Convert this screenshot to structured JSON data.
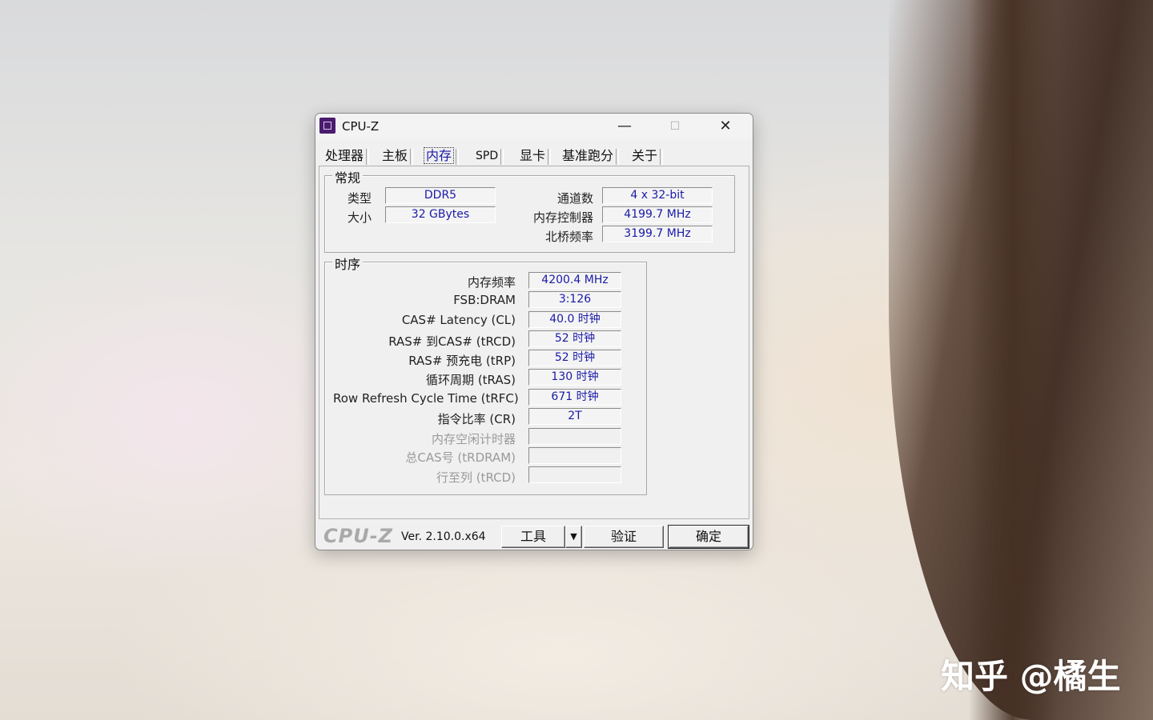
{
  "window": {
    "title": "CPU-Z",
    "minimize_glyph": "—",
    "maximize_glyph": "☐",
    "close_glyph": "✕"
  },
  "tabs": [
    {
      "label": "处理器"
    },
    {
      "label": "主板"
    },
    {
      "label": "内存",
      "active": true
    },
    {
      "label": "SPD"
    },
    {
      "label": "显卡"
    },
    {
      "label": "基准跑分"
    },
    {
      "label": "关于"
    }
  ],
  "general": {
    "title": "常规",
    "type_label": "类型",
    "type_value": "DDR5",
    "size_label": "大小",
    "size_value": "32 GBytes",
    "channels_label": "通道数",
    "channels_value": "4 x 32-bit",
    "mem_controller_label": "内存控制器",
    "mem_controller_value": "4199.7 MHz",
    "northbridge_label": "北桥频率",
    "northbridge_value": "3199.7 MHz"
  },
  "timings": {
    "title": "时序",
    "rows": [
      {
        "label": "内存频率",
        "value": "4200.4 MHz"
      },
      {
        "label": "FSB:DRAM",
        "value": "3:126"
      },
      {
        "label": "CAS# Latency (CL)",
        "value": "40.0 时钟"
      },
      {
        "label": "RAS# 到CAS# (tRCD)",
        "value": "52 时钟"
      },
      {
        "label": "RAS# 预充电 (tRP)",
        "value": "52 时钟"
      },
      {
        "label": "循环周期 (tRAS)",
        "value": "130 时钟"
      },
      {
        "label": "Row Refresh Cycle Time (tRFC)",
        "value": "671 时钟"
      },
      {
        "label": "指令比率 (CR)",
        "value": "2T"
      },
      {
        "label": "内存空闲计时器",
        "value": ""
      },
      {
        "label": "总CAS号 (tRDRAM)",
        "value": ""
      },
      {
        "label": "行至列 (tRCD)",
        "value": ""
      }
    ]
  },
  "footer": {
    "brand": "CPU-Z",
    "version": "Ver. 2.10.0.x64",
    "tools_label": "工具",
    "dropdown_glyph": "▼",
    "validate_label": "验证",
    "ok_label": "确定"
  },
  "watermark": "知乎 @橘生"
}
